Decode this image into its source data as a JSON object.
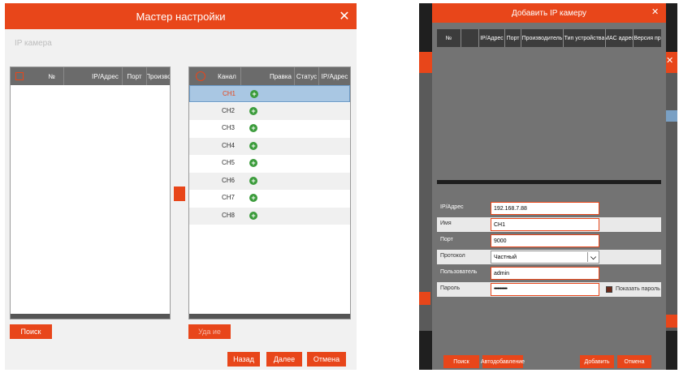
{
  "wizard": {
    "title": "Мастер настройки",
    "section": "IP камера",
    "left_headers": [
      "№",
      "IP/Адрес",
      "Порт",
      "Произво"
    ],
    "right_headers": [
      "Канал",
      "Правка",
      "Статус",
      "IP/Адрес"
    ],
    "channels": [
      "CH1",
      "CH2",
      "CH3",
      "CH4",
      "CH5",
      "CH6",
      "CH7",
      "CH8"
    ],
    "search_button": "Поиск",
    "delete_button": "Уда ие",
    "back_button": "Назад",
    "next_button": "Далее",
    "cancel_button": "Отмена"
  },
  "dialog": {
    "title": "Добавить IP камеру",
    "headers": [
      "№",
      "IP/Адрес",
      "Порт",
      "Производитель",
      "Тип устройства",
      "MAC адрес",
      "Версия пр"
    ],
    "ip_label": "IP/Адрес",
    "ip_value": "192.168.7.88",
    "name_label": "Имя",
    "name_value": "CH1",
    "port_label": "Порт",
    "port_value": "9000",
    "protocol_label": "Протокол",
    "protocol_value": "Частный",
    "user_label": "Пользователь",
    "user_value": "admin",
    "password_label": "Пароль",
    "password_value": "•••••••••••",
    "show_password_label": "Показать пароль",
    "search_button": "Поиск",
    "autoadd_button": "Автодобавление",
    "add_button": "Добавить",
    "cancel_button": "Отмена"
  },
  "colors": {
    "accent": "#e8461a",
    "highlight": "#a9c7e3",
    "plus": "#3a9b3a"
  }
}
